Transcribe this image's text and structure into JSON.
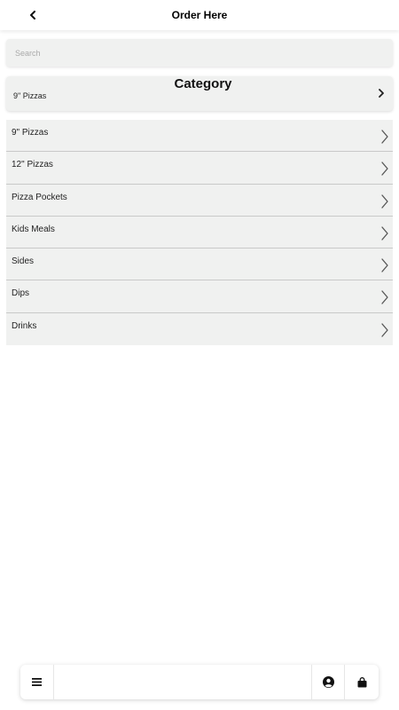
{
  "header": {
    "title": "Order Here",
    "back_icon": "chevron-left-icon"
  },
  "search": {
    "placeholder": "Search",
    "value": ""
  },
  "category": {
    "title": "Category",
    "selected": "9\" Pizzas",
    "chevron_icon": "chevron-right-icon"
  },
  "categories": [
    {
      "label": "9\" Pizzas"
    },
    {
      "label": "12\" Pizzas"
    },
    {
      "label": "Pizza Pockets"
    },
    {
      "label": "Kids Meals"
    },
    {
      "label": "Sides"
    },
    {
      "label": "Dips"
    },
    {
      "label": "Drinks"
    }
  ],
  "bottom_bar": {
    "menu_icon": "hamburger-menu-icon",
    "user_icon": "user-circle-icon",
    "cart_icon": "shopping-bag-icon"
  },
  "colors": {
    "panel_bg": "#f0f1f0",
    "divider": "#c9c9c9",
    "text": "#222222"
  }
}
